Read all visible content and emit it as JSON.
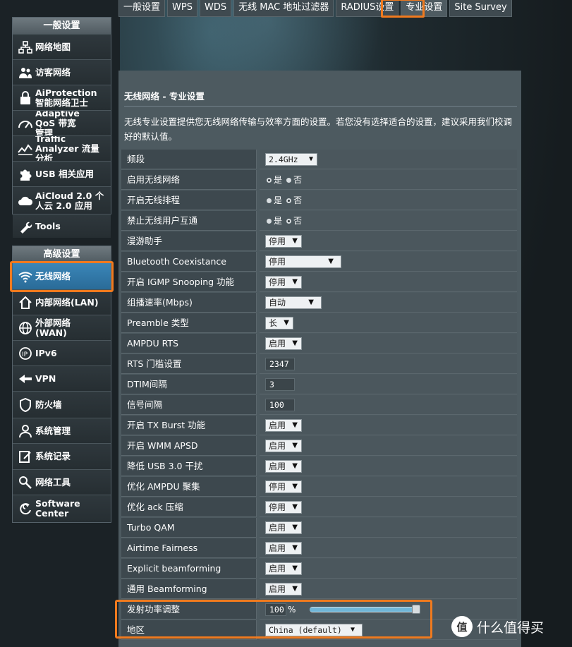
{
  "tabs": [
    "一般设置",
    "WPS",
    "WDS",
    "无线 MAC 地址过滤器",
    "RADIUS设置",
    "专业设置",
    "Site Survey"
  ],
  "sidebar": {
    "general_header": "一般设置",
    "general_items": [
      "网络地图",
      "访客网络",
      "AiProtection 智能网络卫士",
      "Adaptive QoS 带宽管理",
      "Traffic Analyzer 流量分析",
      "USB 相关应用",
      "AiCloud 2.0 个人云 2.0 应用",
      "Tools"
    ],
    "advanced_header": "高级设置",
    "advanced_items": [
      "无线网络",
      "内部网络(LAN)",
      "外部网络(WAN)",
      "IPv6",
      "VPN",
      "防火墙",
      "系统管理",
      "系统记录",
      "网络工具",
      "Software Center"
    ],
    "active_item": "无线网络"
  },
  "panel": {
    "title": "无线网络 - 专业设置",
    "description": "无线专业设置提供您无线网络传输与效率方面的设置。若您没有选择适合的设置，建议采用我们校调好的默认值。"
  },
  "radio_labels": {
    "yes": "是",
    "no": "否"
  },
  "settings": {
    "band": {
      "label": "频段",
      "value": "2.4GHz"
    },
    "enable_radio": {
      "label": "启用无线网络",
      "selected": "yes"
    },
    "enable_schedule": {
      "label": "开启无线排程",
      "selected": "no"
    },
    "ap_isolation": {
      "label": "禁止无线用户互通",
      "selected": "no"
    },
    "roaming": {
      "label": "漫游助手",
      "value": "停用"
    },
    "bt_coex": {
      "label": "Bluetooth Coexistance",
      "value": "停用"
    },
    "igmp": {
      "label": "开启 IGMP Snooping 功能",
      "value": "停用"
    },
    "mcast_rate": {
      "label": "组播速率(Mbps)",
      "value": "自动"
    },
    "preamble": {
      "label": "Preamble 类型",
      "value": "长"
    },
    "ampdu_rts": {
      "label": "AMPDU RTS",
      "value": "启用"
    },
    "rts": {
      "label": "RTS 门槛设置",
      "value": "2347"
    },
    "dtim": {
      "label": "DTIM间隔",
      "value": "3"
    },
    "beacon": {
      "label": "信号间隔",
      "value": "100"
    },
    "tx_burst": {
      "label": "开启 TX Burst 功能",
      "value": "启用"
    },
    "wmm_apsd": {
      "label": "开启 WMM APSD",
      "value": "启用"
    },
    "usb3": {
      "label": "降低 USB 3.0 干扰",
      "value": "启用"
    },
    "ampdu_agg": {
      "label": "优化 AMPDU 聚集",
      "value": "停用"
    },
    "ack": {
      "label": "优化 ack 压缩",
      "value": "停用"
    },
    "turbo_qam": {
      "label": "Turbo QAM",
      "value": "启用"
    },
    "airtime": {
      "label": "Airtime Fairness",
      "value": "启用"
    },
    "explicit_bf": {
      "label": "Explicit beamforming",
      "value": "启用"
    },
    "universal_bf": {
      "label": "通用 Beamforming",
      "value": "启用"
    },
    "tx_power": {
      "label": "发射功率调整",
      "value": "100",
      "unit": "%",
      "slider_fraction": 1.0
    },
    "region": {
      "label": "地区",
      "value": "China (default)"
    }
  },
  "watermark": {
    "logo": "值",
    "text": "什么值得买"
  },
  "colors": {
    "highlight": "#f07a1e",
    "active_blue": "#2f78aa",
    "slider_fill": "#6fb6d8"
  }
}
